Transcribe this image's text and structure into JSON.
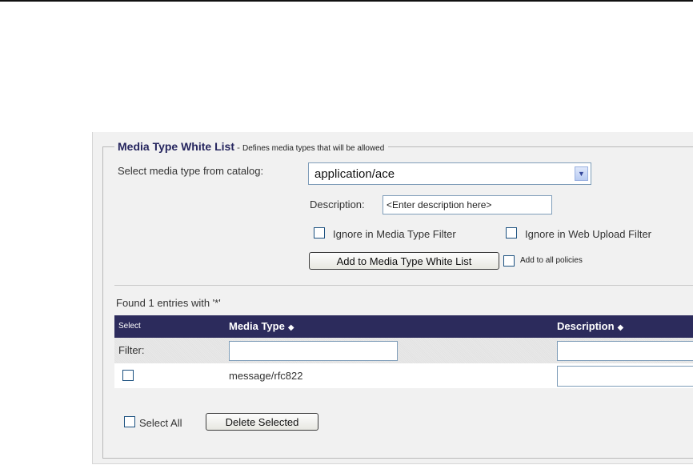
{
  "section": {
    "title": "Media Type White List",
    "separator": "-",
    "subtitle": "Defines media types that will be allowed"
  },
  "catalog": {
    "label": "Select media type from catalog:",
    "selected": "application/ace",
    "arrow": "▼"
  },
  "description": {
    "label": "Description:",
    "placeholder": "<Enter description here>"
  },
  "options": {
    "ignore_media_filter": "Ignore in Media Type Filter",
    "ignore_upload_filter": "Ignore in Web Upload Filter"
  },
  "actions": {
    "add_button": "Add to Media Type White List",
    "add_all_label": "Add to all policies"
  },
  "results": {
    "summary": "Found 1 entries with '*'"
  },
  "table": {
    "columns": {
      "select": "Select",
      "media_type": "Media Type",
      "description": "Description"
    },
    "sort_icon": "◆",
    "filter_label": "Filter:",
    "rows": [
      {
        "media_type": "message/rfc822",
        "description": ""
      }
    ]
  },
  "footer": {
    "select_all": "Select All",
    "delete_button": "Delete Selected"
  }
}
